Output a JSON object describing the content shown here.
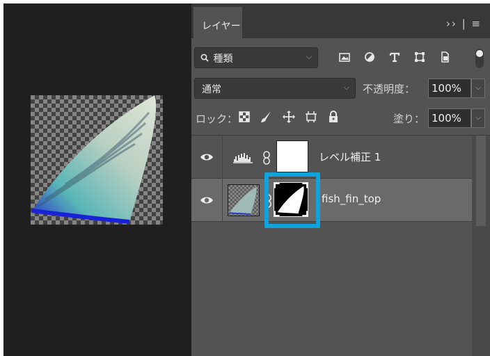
{
  "panel": {
    "tab_label": "レイヤー",
    "tab_tools": "›› | ≡"
  },
  "filter": {
    "kind_label": "種類",
    "icons": [
      "search-icon",
      "image-filter-icon",
      "adjustment-filter-icon",
      "type-filter-icon",
      "shape-filter-icon",
      "smart-object-filter-icon"
    ]
  },
  "blend": {
    "mode": "通常",
    "opacity_label": "不透明度：",
    "opacity_value": "100%"
  },
  "lock": {
    "label": "ロック：",
    "icons": [
      "lock-transparent-icon",
      "lock-image-icon",
      "lock-position-icon",
      "lock-artboard-icon",
      "lock-all-icon"
    ],
    "fill_label": "塗り：",
    "fill_value": "100%"
  },
  "layers": [
    {
      "name": "レベル補正 1",
      "type": "adjustment",
      "visible": true,
      "selected": false
    },
    {
      "name": "fish_fin_top",
      "type": "pixel-with-mask",
      "visible": true,
      "selected": true
    }
  ],
  "colors": {
    "panel_bg": "#535353",
    "selected_layer": "#6a6a6a",
    "highlight": "#0ea3dd",
    "canvas_bg": "#1f1f1f"
  }
}
